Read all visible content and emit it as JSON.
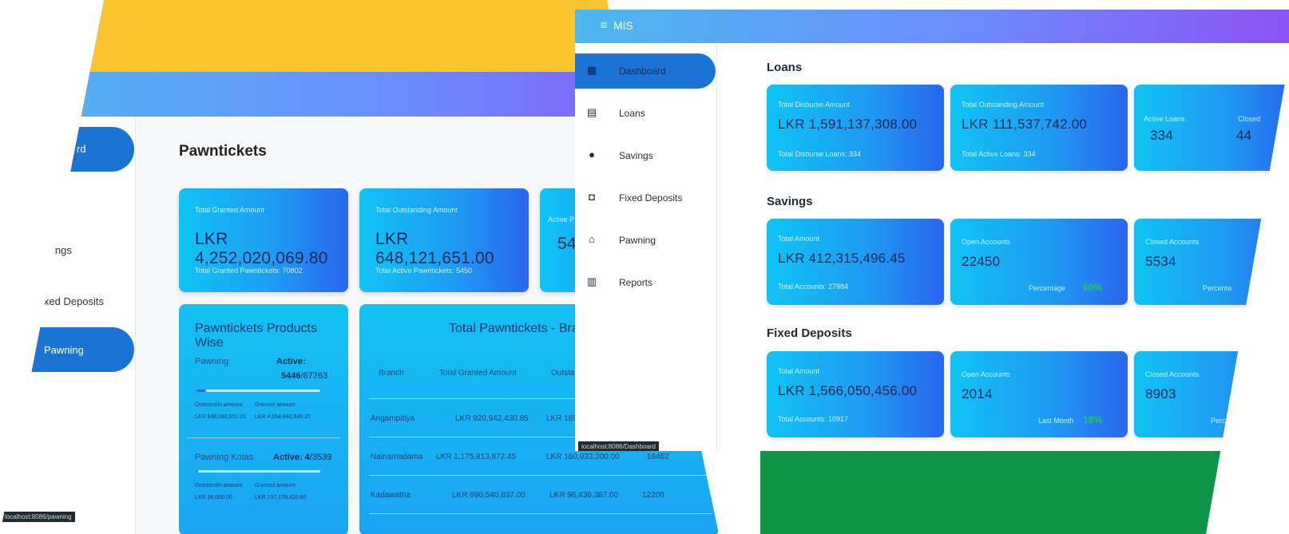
{
  "pawning_page": {
    "nav": {
      "item_dashboard": "rd",
      "item_savings": "ings",
      "item_fixed_deposits": "ixed Deposits",
      "item_pawning": "Pawning"
    },
    "title": "Pawntickets",
    "cards": [
      {
        "caption": "Total Granted Amount",
        "value": "LKR 4,252,020,069.80",
        "sub": "Total Granted Pawntickets: 70802"
      },
      {
        "caption": "Total Outstanding Amount",
        "value": "LKR 648,121,651.00",
        "sub": "Total Active Pawntickets: 5450"
      },
      {
        "caption": "Active P",
        "value": "545"
      }
    ],
    "products": {
      "title": "Pawntickets Products Wise",
      "items": [
        {
          "name": "Pawning",
          "active_label": "Active:",
          "active_value": "5446",
          "total": "/67263",
          "outstanding_label": "Outstandin amount",
          "outstanding_value": "LKR 648,082,651.00",
          "granted_label": "Granted amount",
          "granted_value": "LKR 4,054,840,649.20",
          "fill": 0.08
        },
        {
          "name": "Pawning Kotas",
          "active_label": "Active:",
          "active_value": "4",
          "total": "/3539",
          "outstanding_label": "Outstandin amount",
          "outstanding_value": "LKR 38,000.00",
          "granted_label": "Granted amount",
          "granted_value": "LKR 197,179,420.60",
          "fill": 0.01
        }
      ]
    },
    "branch_table": {
      "title": "Total Pawntickets - Branc",
      "headers": [
        "Branch",
        "Total Granted Amount",
        "Outstan"
      ],
      "rows": [
        [
          "Angampitiya",
          "LKR 920,942,430.85",
          "LKR 169,",
          ""
        ],
        [
          "Nainamadama",
          "LKR 1,175,813,872.45",
          "LKR 160,933,300.00",
          "16462"
        ],
        [
          "Kadawatha",
          "LKR 690,540,837.00",
          "LKR 96,436,387.00",
          "12200"
        ]
      ]
    },
    "status_bar": "localhost:8086/pawning"
  },
  "dashboard_page": {
    "header": {
      "menu_icon": "≡",
      "app_title": "MIS"
    },
    "nav": [
      {
        "label": "Dashboard",
        "icon": "dashboard-icon",
        "glyph": "▦",
        "active": true
      },
      {
        "label": "Loans",
        "icon": "loan-document-icon",
        "glyph": "▤",
        "active": false
      },
      {
        "label": "Savings",
        "icon": "piggy-bank-icon",
        "glyph": "●",
        "active": false
      },
      {
        "label": "Fixed Deposits",
        "icon": "deposit-icon",
        "glyph": "◘",
        "active": false
      },
      {
        "label": "Pawning",
        "icon": "bank-icon",
        "glyph": "⌂",
        "active": false
      },
      {
        "label": "Reports",
        "icon": "reports-icon",
        "glyph": "▥",
        "active": false
      }
    ],
    "status_bar": "localhost:8086/Dashboard",
    "sections": {
      "loans": {
        "title": "Loans",
        "card1": {
          "caption": "Total Disburse Amount",
          "value": "LKR 1,591,137,308.00",
          "sub": "Total Disburse Loans: 334"
        },
        "card2": {
          "caption": "Total Outstanding Amount",
          "value": "LKR 111,537,742.00",
          "sub": "Total Active Loans: 334"
        },
        "card3": {
          "caption_a": "Active Loans",
          "value_a": "334",
          "caption_b": "Closed",
          "value_b": "44"
        }
      },
      "savings": {
        "title": "Savings",
        "card1": {
          "caption": "Total Amount",
          "value": "LKR 412,315,496.45",
          "sub": "Total Accounts: 27984"
        },
        "card2": {
          "caption": "Open Accounts",
          "value": "22450",
          "pct_label": "Percentage",
          "pct": "80%"
        },
        "card3": {
          "caption": "Closed Accounts",
          "value": "5534",
          "pct_label": "Percenta"
        }
      },
      "fixed_deposits": {
        "title": "Fixed Deposits",
        "card1": {
          "caption": "Total Amount",
          "value": "LKR 1,566,050,456.00",
          "sub": "Total Accounts: 10917"
        },
        "card2": {
          "caption": "Open Accounts",
          "value": "2014",
          "pct_label": "Last Month",
          "pct": "18%"
        },
        "card3": {
          "caption": "Closed Accounts",
          "value": "8903",
          "pct_label": "Perce"
        }
      }
    }
  },
  "colors": {
    "yellow_band": "#fcc42f",
    "header_gradient_start": "#4db8ef",
    "header_gradient_end": "#8b53f4",
    "card_gradient_start": "#10c3f4",
    "card_gradient_end": "#2a66ef",
    "active_nav": "#1b74d4",
    "green_block": "#0d9447",
    "percent_green": "#1ecb5a"
  }
}
